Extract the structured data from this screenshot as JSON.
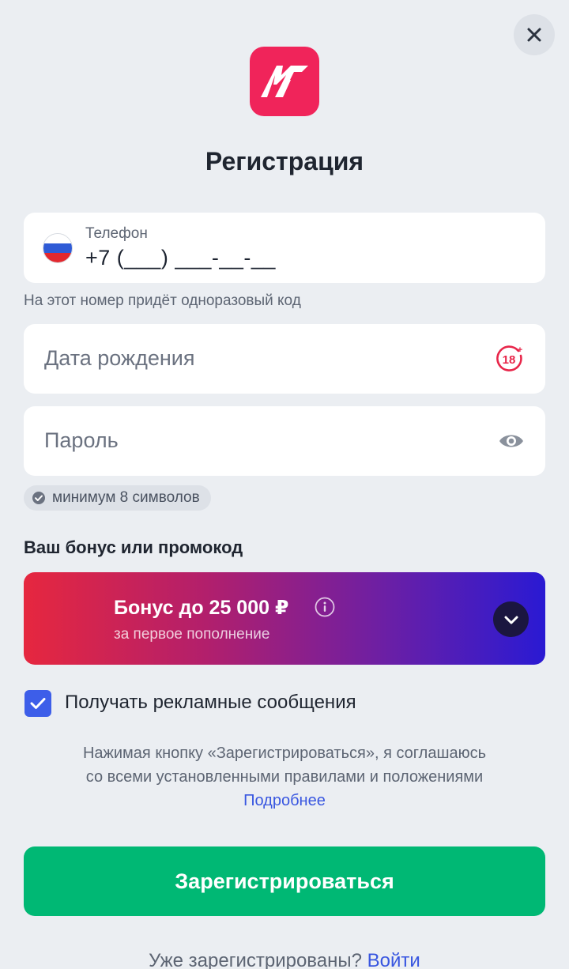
{
  "header": {
    "title": "Регистрация",
    "close_icon": "close-icon",
    "logo_icon": "brand-logo"
  },
  "phone": {
    "label": "Телефон",
    "value": "+7 (___) ___-__-__",
    "country_flag": "russia-flag-icon",
    "hint": "На этот номер придёт одноразовый код"
  },
  "birthdate": {
    "placeholder": "Дата рождения",
    "icon": "age-18-plus-icon",
    "icon_text": "18",
    "icon_plus": "+"
  },
  "password": {
    "placeholder": "Пароль",
    "icon": "eye-icon",
    "rule": "минимум 8 символов",
    "rule_icon": "check-circle-icon"
  },
  "bonus": {
    "section_title": "Ваш бонус или промокод",
    "title": "Бонус до 25 000 ₽",
    "subtitle": "за первое пополнение",
    "info_icon": "info-icon",
    "expand_icon": "chevron-down-icon"
  },
  "marketing": {
    "checked": true,
    "label": "Получать рекламные сообщения"
  },
  "terms": {
    "line1": "Нажимая кнопку «Зарегистрироваться», я соглашаюсь",
    "line2": "со всеми установленными правилами и положениями",
    "link": "Подробнее"
  },
  "register_button": "Зарегистрироваться",
  "login": {
    "prompt": "Уже зарегистрированы?",
    "link": "Войти"
  },
  "colors": {
    "background": "#ebeef2",
    "brand": "#f0245a",
    "accent": "#3856e0",
    "primary_button": "#00b874",
    "age_badge": "#e8264a"
  }
}
